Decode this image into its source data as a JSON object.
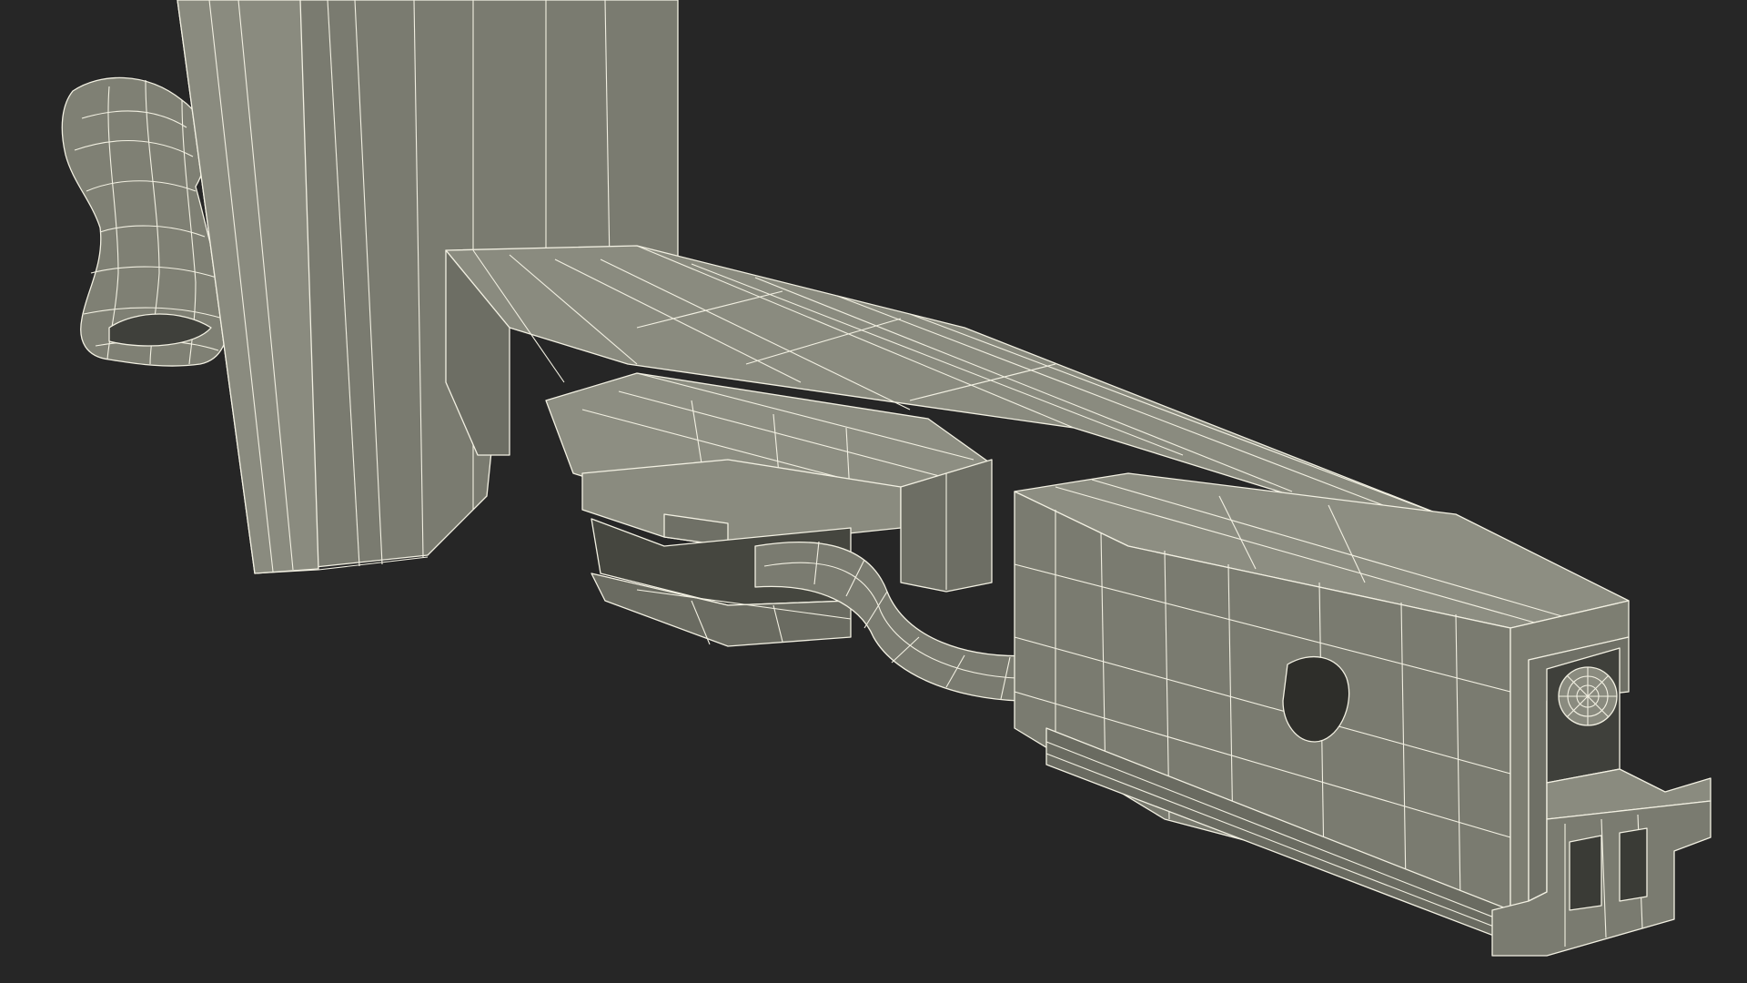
{
  "scene": {
    "subject": "wireframe-3d-model",
    "colors": {
      "background": "#262626",
      "surface": "#7d7e72",
      "surface_light": "#8a8b7f",
      "surface_dark": "#5f6058",
      "surface_shadow": "#3f403b",
      "wireframe": "#f2f0e2"
    }
  }
}
